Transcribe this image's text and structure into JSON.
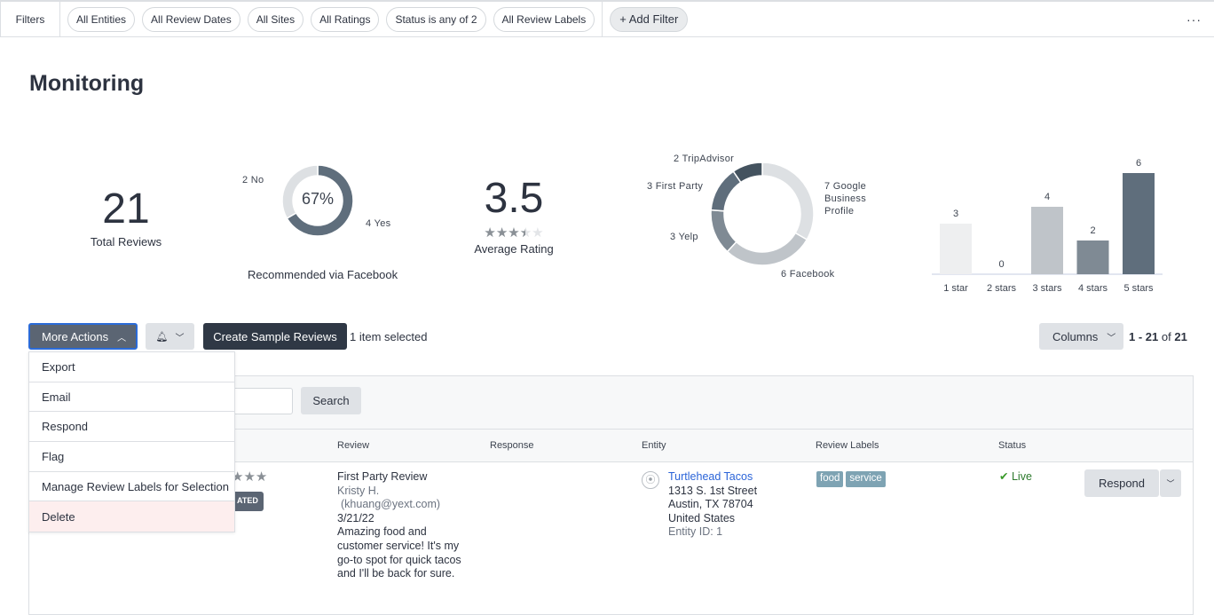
{
  "filters": {
    "label": "Filters",
    "chips": [
      "All Entities",
      "All Review Dates",
      "All Sites",
      "All Ratings",
      "Status is any of 2",
      "All Review Labels"
    ],
    "add": "+ Add Filter",
    "more": "···"
  },
  "title": "Monitoring",
  "total": {
    "value": "21",
    "label": "Total Reviews"
  },
  "recommend": {
    "center": "67%",
    "no": "2 No",
    "yes": "4 Yes",
    "label": "Recommended via Facebook"
  },
  "avg": {
    "value": "3.5",
    "label": "Average Rating",
    "rating": 3.5,
    "stars": "★★★★★"
  },
  "chart_data": [
    {
      "type": "pie",
      "variant": "donut",
      "title": "Recommended via Facebook",
      "slices": [
        {
          "label": "Yes",
          "value": 4,
          "color": "#5f6e7c"
        },
        {
          "label": "No",
          "value": 2,
          "color": "#dde0e3"
        }
      ]
    },
    {
      "type": "pie",
      "variant": "donut",
      "slices": [
        {
          "label": "7 Google Business Profile",
          "lines": [
            "7 Google",
            "Business",
            "Profile"
          ],
          "value": 7,
          "color": "#dde0e3"
        },
        {
          "label": "6 Facebook",
          "value": 6,
          "color": "#bfc4c9"
        },
        {
          "label": "3 Yelp",
          "value": 3,
          "color": "#7f8a94"
        },
        {
          "label": "3 First Party",
          "value": 3,
          "color": "#5f6e7c"
        },
        {
          "label": "2 TripAdvisor",
          "value": 2,
          "color": "#44535f"
        }
      ]
    },
    {
      "type": "bar",
      "categories": [
        "1 star",
        "2 stars",
        "3 stars",
        "4 stars",
        "5 stars"
      ],
      "values": [
        3,
        0,
        4,
        2,
        6
      ],
      "colors": [
        "#eeeff0",
        "#e0e2e4",
        "#bfc4c9",
        "#7f8a94",
        "#5f6e7c"
      ],
      "ylim": [
        0,
        6
      ]
    }
  ],
  "actions": {
    "more": "More Actions",
    "create": "Create Sample Reviews",
    "selected": "1 item selected",
    "columns": "Columns",
    "pagination": {
      "range": "1 - 21",
      "of": "of",
      "total": "21"
    }
  },
  "menu": [
    "Export",
    "Email",
    "Respond",
    "Flag",
    "Manage Review Labels for Selection",
    "Delete"
  ],
  "search": {
    "button": "Search",
    "value": ""
  },
  "table": {
    "headers": [
      "Review",
      "Response",
      "Entity",
      "Review Labels",
      "Status"
    ],
    "row": {
      "stars": "★★★",
      "badge": "ATED",
      "review": {
        "type": "First Party Review",
        "author": "Kristy H.",
        "email": "(khuang@yext.com)",
        "date": "3/21/22",
        "text": "Amazing food and customer service! It's my go-to spot for quick tacos and I'll be back for sure."
      },
      "entity": {
        "name": "Turtlehead Tacos",
        "address1": "1313 S. 1st Street",
        "address2": "Austin, TX 78704",
        "country": "United States",
        "id": "Entity ID: 1"
      },
      "labels": [
        "food",
        "service"
      ],
      "status": "Live",
      "respond": "Respond"
    }
  }
}
